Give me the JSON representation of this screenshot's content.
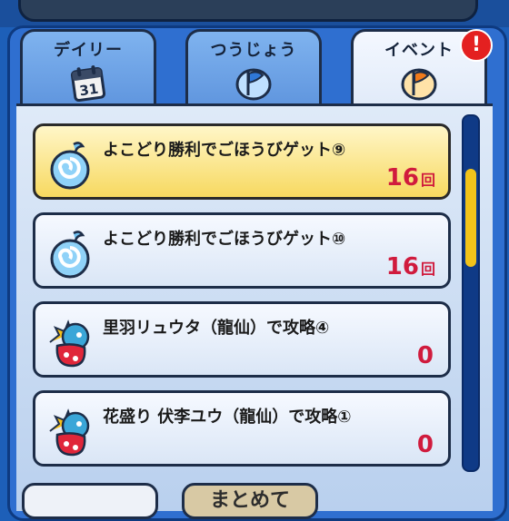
{
  "tabs": [
    {
      "label": "デイリー",
      "icon": "calendar-icon",
      "calendar_day": "31"
    },
    {
      "label": "つうじょう",
      "icon": "blue-flag-icon"
    },
    {
      "label": "イベント",
      "icon": "orange-flag-icon",
      "active": true
    }
  ],
  "notification_badge": "!",
  "scroll": {
    "position_fraction": 0.2
  },
  "missions": [
    {
      "title": "よこどり勝利でごほうびゲット⑨",
      "count": "16",
      "unit": "回",
      "icon": "blue-swirl-orb-icon",
      "highlighted": true
    },
    {
      "title": "よこどり勝利でごほうびゲット⑩",
      "count": "16",
      "unit": "回",
      "icon": "blue-swirl-orb-icon",
      "highlighted": false
    },
    {
      "title": "里羽リュウタ（龍仙）で攻略④",
      "count": "0",
      "unit": "",
      "icon": "dragon-character-icon",
      "highlighted": false
    },
    {
      "title": "花盛り 伏李ユウ（龍仙）で攻略①",
      "count": "0",
      "unit": "",
      "icon": "dragon-character-icon",
      "highlighted": false
    }
  ],
  "bottom_buttons": [
    {
      "label": ""
    },
    {
      "label": "まとめて"
    }
  ],
  "colors": {
    "frame": "#2f6fd0",
    "highlight_card": "#f7d960",
    "count_text": "#d01b3d",
    "badge": "#e42020",
    "scroll_thumb": "#f2c31a"
  }
}
